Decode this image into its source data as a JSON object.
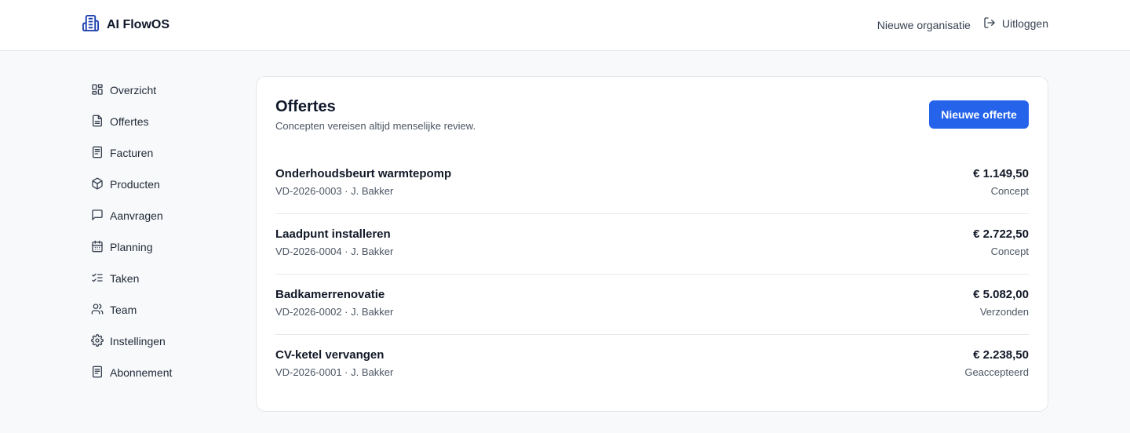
{
  "header": {
    "app_name": "AI FlowOS",
    "new_org_label": "Nieuwe organisatie",
    "logout_label": "Uitloggen"
  },
  "sidebar": {
    "items": [
      {
        "label": "Overzicht",
        "icon": "layout-grid-icon"
      },
      {
        "label": "Offertes",
        "icon": "file-text-icon"
      },
      {
        "label": "Facturen",
        "icon": "receipt-icon"
      },
      {
        "label": "Producten",
        "icon": "package-icon"
      },
      {
        "label": "Aanvragen",
        "icon": "message-square-icon"
      },
      {
        "label": "Planning",
        "icon": "calendar-icon"
      },
      {
        "label": "Taken",
        "icon": "list-checks-icon"
      },
      {
        "label": "Team",
        "icon": "users-icon"
      },
      {
        "label": "Instellingen",
        "icon": "settings-icon"
      },
      {
        "label": "Abonnement",
        "icon": "receipt-icon"
      }
    ]
  },
  "main": {
    "title": "Offertes",
    "subtitle": "Concepten vereisen altijd menselijke review.",
    "new_button_label": "Nieuwe offerte",
    "quotes": [
      {
        "title": "Onderhoudsbeurt warmtepomp",
        "meta": "VD-2026-0003 · J. Bakker",
        "amount": "€ 1.149,50",
        "status": "Concept"
      },
      {
        "title": "Laadpunt installeren",
        "meta": "VD-2026-0004 · J. Bakker",
        "amount": "€ 2.722,50",
        "status": "Concept"
      },
      {
        "title": "Badkamerrenovatie",
        "meta": "VD-2026-0002 · J. Bakker",
        "amount": "€ 5.082,00",
        "status": "Verzonden"
      },
      {
        "title": "CV-ketel vervangen",
        "meta": "VD-2026-0001 · J. Bakker",
        "amount": "€ 2.238,50",
        "status": "Geaccepteerd"
      }
    ]
  },
  "colors": {
    "accent": "#2563eb",
    "brand_icon": "#1e40af",
    "background": "#f8f9fb",
    "border": "#e5e7eb"
  }
}
